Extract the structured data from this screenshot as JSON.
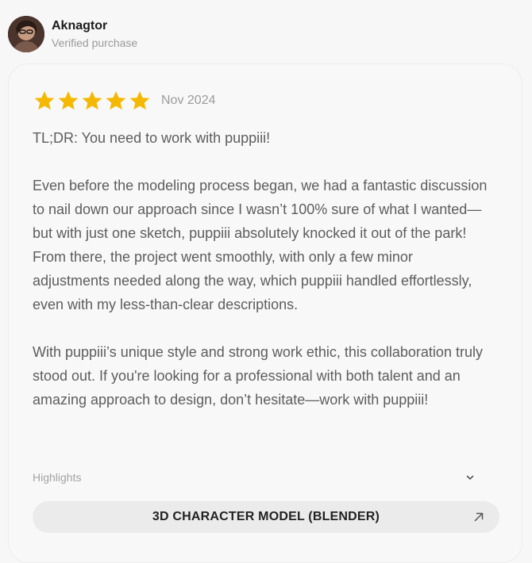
{
  "reviewer": {
    "name": "Aknagtor",
    "status": "Verified purchase"
  },
  "review": {
    "rating": 5,
    "rating_max": 5,
    "date": "Nov 2024",
    "paragraphs": [
      "TL;DR: You need to work with puppiii!",
      "Even before the modeling process began, we had a fantastic discussion to nail down our approach since I wasn’t 100% sure of what I wanted—but with just one sketch, puppiii absolutely knocked it out of the park! From there, the project went smoothly, with only a few minor adjustments needed along the way, which puppiii handled effortlessly, even with my less-than-clear descriptions.",
      "With puppiii’s unique style and strong work ethic, this collaboration truly stood out. If you're looking for a professional with both talent and an amazing approach to design, don’t hesitate—work with puppiii!"
    ]
  },
  "highlights": {
    "label": "Highlights",
    "icon": "chevron-down-icon"
  },
  "tag": {
    "label": "3D CHARACTER MODEL (BLENDER)",
    "icon": "arrow-up-right-icon"
  },
  "colors": {
    "star": "#f5b800",
    "background": "#f7f7f7",
    "tag_background": "#ebebeb"
  }
}
